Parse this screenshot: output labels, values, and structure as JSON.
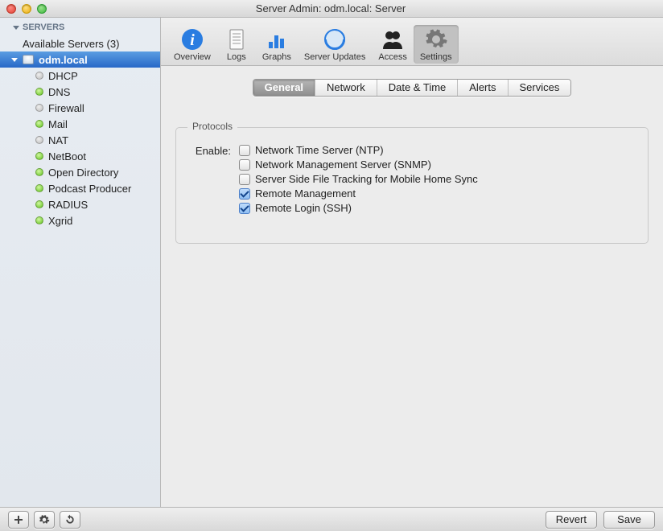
{
  "window": {
    "title": "Server Admin: odm.local: Server"
  },
  "sidebar": {
    "header": "Servers",
    "available_label": "Available Servers (3)",
    "server_name": "odm.local",
    "services": [
      {
        "name": "DHCP",
        "status": "gray"
      },
      {
        "name": "DNS",
        "status": "green"
      },
      {
        "name": "Firewall",
        "status": "gray"
      },
      {
        "name": "Mail",
        "status": "green"
      },
      {
        "name": "NAT",
        "status": "gray"
      },
      {
        "name": "NetBoot",
        "status": "green"
      },
      {
        "name": "Open Directory",
        "status": "green"
      },
      {
        "name": "Podcast Producer",
        "status": "green"
      },
      {
        "name": "RADIUS",
        "status": "green"
      },
      {
        "name": "Xgrid",
        "status": "green"
      }
    ]
  },
  "toolbar": {
    "items": [
      {
        "label": "Overview",
        "icon": "overview-icon"
      },
      {
        "label": "Logs",
        "icon": "logs-icon"
      },
      {
        "label": "Graphs",
        "icon": "graphs-icon"
      },
      {
        "label": "Server Updates",
        "icon": "server-updates-icon"
      },
      {
        "label": "Access",
        "icon": "access-icon"
      },
      {
        "label": "Settings",
        "icon": "settings-icon"
      }
    ],
    "selected": "Settings"
  },
  "tabs": {
    "items": [
      "General",
      "Network",
      "Date & Time",
      "Alerts",
      "Services"
    ],
    "active": "General"
  },
  "protocols": {
    "legend": "Protocols",
    "enable_label": "Enable:",
    "options": [
      {
        "label": "Network Time Server (NTP)",
        "checked": false
      },
      {
        "label": "Network Management Server (SNMP)",
        "checked": false
      },
      {
        "label": "Server Side File Tracking for Mobile Home Sync",
        "checked": false
      },
      {
        "label": "Remote Management",
        "checked": true
      },
      {
        "label": "Remote Login (SSH)",
        "checked": true
      }
    ]
  },
  "bottombar": {
    "add": "+",
    "action": "✻",
    "refresh": "⟲",
    "revert": "Revert",
    "save": "Save"
  }
}
